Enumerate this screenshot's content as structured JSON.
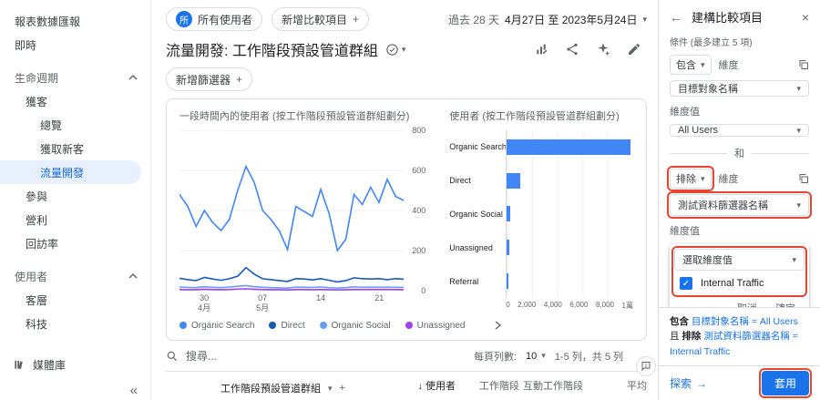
{
  "colors": {
    "accent": "#1a73e8",
    "annotation": "#e8442f",
    "nav_selected_bg": "#e8f0fe",
    "nav_selected_text": "#1967d2"
  },
  "icons": {
    "caret_down": "▾",
    "plus": "+",
    "close": "×",
    "back": "←",
    "collapse": "«",
    "sort_desc": "↓",
    "arrow_right": "→",
    "check": "✓"
  },
  "sidebar": {
    "snapshot": "報表數據匯報",
    "realtime": "即時",
    "lifecycle_header": "生命週期",
    "acquisition": "獲客",
    "overview": "總覽",
    "user_acquisition": "獲取新客",
    "traffic_acquisition": "流量開發",
    "engagement": "參與",
    "monetization": "營利",
    "retention": "回訪率",
    "user_header": "使用者",
    "demographics": "客層",
    "tech": "科技",
    "library": "媒體庫"
  },
  "topbar": {
    "audience_badge": "所",
    "audience_chip": "所有使用者",
    "add_comparison": "新增比較項目",
    "date_preset": "過去 28 天",
    "date_range": "4月27日 至 2023年5月24日"
  },
  "report_header": {
    "title": "流量開發: 工作階段預設管道群組",
    "add_filter": "新增篩選器"
  },
  "chart_data": [
    {
      "type": "line",
      "title": "一段時間內的使用者 (按工作階段預設管道群組劃分)",
      "ylim": [
        0,
        800
      ],
      "yticks": [
        0,
        200,
        400,
        600,
        800
      ],
      "xticks": [
        {
          "d": "30",
          "m": "4月"
        },
        {
          "d": "07",
          "m": "5月"
        },
        {
          "d": "14",
          "m": ""
        },
        {
          "d": "21",
          "m": ""
        }
      ],
      "x_range": "4月27日 至 2023年5月24日",
      "series": [
        {
          "name": "Organic Search",
          "color": "#4285f4",
          "values": [
            480,
            420,
            320,
            400,
            340,
            300,
            355,
            500,
            620,
            540,
            400,
            355,
            300,
            205,
            420,
            395,
            370,
            505,
            385,
            200,
            255,
            480,
            430,
            515,
            440,
            555,
            470,
            450
          ]
        },
        {
          "name": "Direct",
          "color": "#185abc",
          "values": [
            62,
            55,
            50,
            66,
            58,
            52,
            60,
            72,
            115,
            82,
            60,
            55,
            50,
            46,
            60,
            58,
            54,
            60,
            52,
            44,
            50,
            64,
            60,
            58,
            60,
            55,
            60,
            57
          ]
        },
        {
          "name": "Organic Social",
          "color": "#669df6",
          "values": [
            18,
            16,
            15,
            20,
            17,
            15,
            18,
            22,
            25,
            20,
            17,
            15,
            14,
            13,
            18,
            17,
            16,
            18,
            15,
            13,
            15,
            19,
            17,
            18,
            17,
            18,
            17,
            16
          ]
        },
        {
          "name": "Unassigned",
          "color": "#a142f4",
          "values": [
            6,
            5,
            5,
            7,
            6,
            5,
            6,
            8,
            9,
            7,
            6,
            5,
            5,
            4,
            6,
            6,
            5,
            6,
            5,
            4,
            5,
            6,
            6,
            6,
            6,
            6,
            6,
            5
          ]
        }
      ]
    },
    {
      "type": "bar",
      "title": "使用者 (按工作階段預設管道群組劃分)",
      "categories": [
        "Organic Search",
        "Direct",
        "Organic Social",
        "Unassigned",
        "Referral"
      ],
      "values": [
        9800,
        1050,
        260,
        170,
        110
      ],
      "xlim": [
        0,
        10000
      ],
      "xticks": [
        "0",
        "2,000",
        "4,000",
        "6,000",
        "8,000",
        "1萬"
      ],
      "bar_color": "#4285f4"
    }
  ],
  "table": {
    "search_placeholder": "搜尋...",
    "rows_per_page_label": "每頁列數:",
    "rows_per_page_value": "10",
    "pagination_text": "1-5 列，共 5 列",
    "columns": {
      "dimension": "工作階段預設管道群組",
      "users": "使用者",
      "sessions": "工作階段",
      "engaged_sessions": "互動工作階段",
      "avg": "平均"
    }
  },
  "panel": {
    "title": "建構比較項目",
    "conditions_label": "條件 (最多建立 5 項)",
    "dimension_label": "維度",
    "dimension_value_label": "維度值",
    "include_operator": "包含",
    "exclude_operator": "排除",
    "and_label": "和",
    "condition1": {
      "dimension": "目標對象名稱",
      "value": "All Users"
    },
    "condition2": {
      "dimension": "測試資料篩選器名稱",
      "value_placeholder": "選取維度值",
      "option": "Internal Traffic"
    },
    "cancel_label": "取消",
    "ok_label": "確定",
    "summary": {
      "include": "包含",
      "clause1": "目標對象名稱 = All Users",
      "and": "且",
      "exclude": "排除",
      "clause2": "測試資料篩選器名稱 = Internal Traffic"
    },
    "explore_label": "探索",
    "apply_label": "套用"
  }
}
